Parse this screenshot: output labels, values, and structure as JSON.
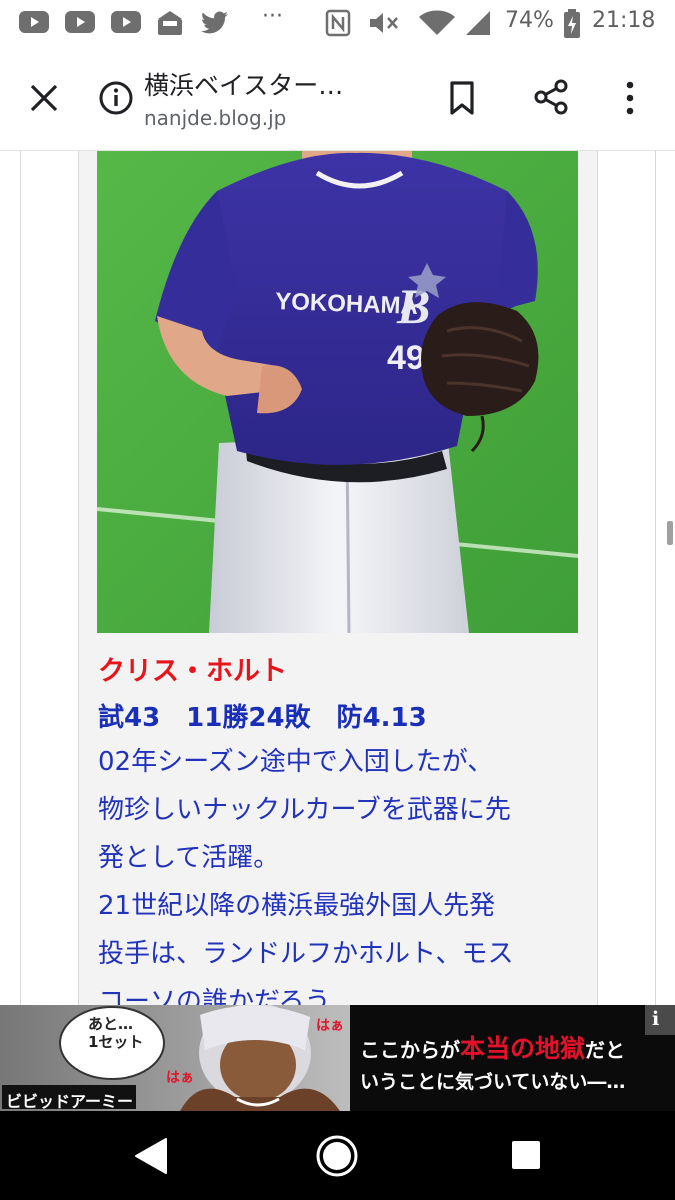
{
  "status_bar": {
    "battery": "74%",
    "time": "21:18",
    "overflow": "···"
  },
  "toolbar": {
    "title": "横浜ベイスター…",
    "url": "nanjde.blog.jp"
  },
  "photo": {
    "jersey_text": "YOKOHAMA",
    "jersey_logo": "B",
    "jersey_number": "49"
  },
  "post": {
    "name": "クリス・ホルト",
    "stats": "試43　11勝24敗　防4.13",
    "description_lines": [
      "02年シーズン途中で入団したが、",
      "物珍しいナックルカーブを武器に先",
      "発として活躍。",
      "21世紀以降の横浜最強外国人先発",
      "投手は、ランドルフかホルト、モス",
      "コーソの誰かだろう"
    ]
  },
  "ad": {
    "speech": "あと…\n1セット",
    "gasp_top": "はぁ",
    "gasp_bottom": "はぁ",
    "brand": "ビビッドアーミー",
    "headline_prefix": "ここからが",
    "headline_emphasis": "本当の地獄",
    "headline_suffix": "だと",
    "subline": "いうことに気づいていない―…",
    "info_label": "i"
  },
  "colors": {
    "name_red": "#e8141c",
    "stats_blue": "#1a2fb8",
    "text_blue": "#2233bb",
    "field_green": "#4caf3e",
    "jersey_blue": "#3b2f9e"
  }
}
